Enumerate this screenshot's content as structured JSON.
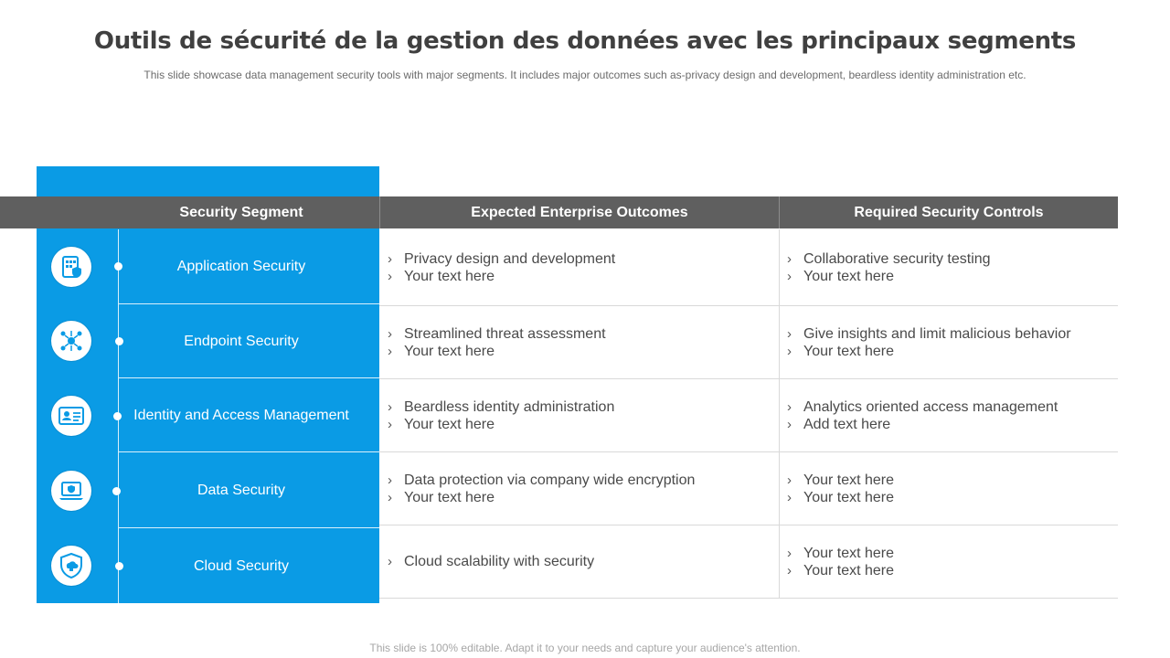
{
  "title": "Outils de sécurité de la gestion des données avec les principaux segments",
  "subtitle": "This slide showcase data management security tools with major segments. It includes major outcomes such as-privacy design and development, beardless identity administration etc.",
  "headers": {
    "segment": "Security Segment",
    "outcomes": "Expected Enterprise Outcomes",
    "controls": "Required Security Controls"
  },
  "rows": [
    {
      "icon": "app-security-icon",
      "segment": "Application Security",
      "outcomes": [
        "Privacy design and development",
        "Your text here"
      ],
      "controls": [
        "Collaborative security testing",
        "Your text here"
      ]
    },
    {
      "icon": "endpoint-network-icon",
      "segment": "Endpoint Security",
      "outcomes": [
        "Streamlined threat assessment",
        "Your text here"
      ],
      "controls": [
        "Give insights and limit malicious behavior",
        "Your text here"
      ]
    },
    {
      "icon": "id-card-icon",
      "segment": "Identity and Access Management",
      "outcomes": [
        "Beardless identity administration",
        "Your text here"
      ],
      "controls": [
        "Analytics oriented access management",
        "Add text here"
      ]
    },
    {
      "icon": "laptop-shield-icon",
      "segment": "Data Security",
      "outcomes": [
        "Data protection via company wide encryption",
        "Your text here"
      ],
      "controls": [
        "Your text here",
        "Your text here"
      ]
    },
    {
      "icon": "cloud-lock-shield-icon",
      "segment": "Cloud Security",
      "outcomes": [
        "Cloud scalability with security"
      ],
      "controls": [
        "Your text here",
        "Your text here"
      ]
    }
  ],
  "bullet_glyph": "›",
  "footer": "This slide is 100% editable. Adapt it to your needs and capture your audience's attention.",
  "colors": {
    "accent": "#0a9be5",
    "header": "#5f5f5f"
  }
}
